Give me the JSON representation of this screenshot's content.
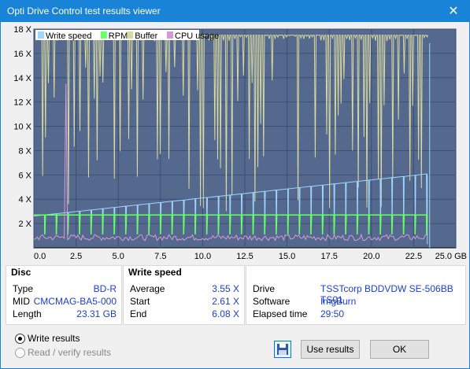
{
  "window": {
    "title": "Opti Drive Control test results viewer",
    "close_glyph": "✕"
  },
  "chart_data": {
    "type": "line",
    "legend": [
      {
        "name": "Write speed",
        "color": "#9fd6ff"
      },
      {
        "name": "RPM",
        "color": "#66ff66"
      },
      {
        "name": "Buffer",
        "color": "#d9d9a0"
      },
      {
        "name": "CPU usage",
        "color": "#d49ad8"
      }
    ],
    "y_ticks": [
      "2 X",
      "4 X",
      "6 X",
      "8 X",
      "10 X",
      "12 X",
      "14 X",
      "16 X",
      "18 X"
    ],
    "x_ticks": [
      "0.0",
      "2.5",
      "5.0",
      "7.5",
      "10.0",
      "12.5",
      "15.0",
      "17.5",
      "20.0",
      "22.5",
      "25.0 GB"
    ],
    "xlim": [
      0,
      25
    ],
    "ylim": [
      0,
      18
    ],
    "background": "#55698f",
    "series": [
      {
        "name": "Write speed",
        "x": [
          0,
          23.31
        ],
        "y": [
          2.61,
          6.08
        ]
      },
      {
        "name": "RPM",
        "x": [
          0,
          23.31
        ],
        "y": [
          2.7,
          2.7
        ]
      },
      {
        "name": "Buffer",
        "x": [
          0,
          23.31
        ],
        "y": [
          17.5,
          17.5
        ]
      },
      {
        "name": "CPU usage",
        "x": [
          0,
          1.8,
          1.9,
          2.0,
          23.31
        ],
        "y": [
          0.7,
          0.7,
          13.5,
          0.7,
          0.9
        ]
      }
    ]
  },
  "disc": {
    "header": "Disc",
    "rows": [
      {
        "label": "Type",
        "value": "BD-R"
      },
      {
        "label": "MID",
        "value": "CMCMAG-BA5-000"
      },
      {
        "label": "Length",
        "value": "23.31 GB"
      }
    ]
  },
  "write_speed": {
    "header": "Write speed",
    "rows": [
      {
        "label": "Average",
        "value": "3.55 X"
      },
      {
        "label": "Start",
        "value": "2.61 X"
      },
      {
        "label": "End",
        "value": "6.08 X"
      }
    ]
  },
  "drive_info": {
    "rows": [
      {
        "label": "Drive",
        "value": "TSSTcorp  BDDVDW SE-506BB TS01"
      },
      {
        "label": "Software",
        "value": "ImgBurn"
      },
      {
        "label": "Elapsed time",
        "value": "29:50"
      }
    ]
  },
  "options": {
    "write_results": "Write results",
    "read_verify_results": "Read / verify results",
    "selected": "write_results"
  },
  "buttons": {
    "use_results": "Use results",
    "ok": "OK"
  }
}
